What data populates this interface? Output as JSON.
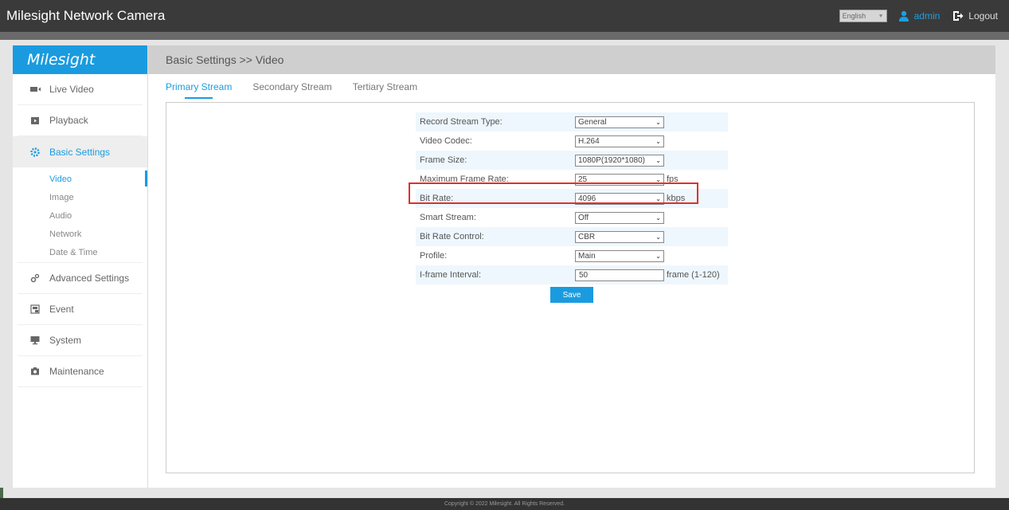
{
  "header": {
    "title": "Milesight Network Camera",
    "language": "English",
    "user": "admin",
    "logout": "Logout"
  },
  "sidebar": {
    "logo": "Milesight",
    "items": [
      {
        "label": "Live Video",
        "icon": "video-camera-icon"
      },
      {
        "label": "Playback",
        "icon": "playback-icon"
      },
      {
        "label": "Basic Settings",
        "icon": "gear-icon"
      },
      {
        "label": "Advanced Settings",
        "icon": "advanced-gear-icon"
      },
      {
        "label": "Event",
        "icon": "event-icon"
      },
      {
        "label": "System",
        "icon": "monitor-icon"
      },
      {
        "label": "Maintenance",
        "icon": "maintenance-icon"
      }
    ],
    "subitems": [
      "Video",
      "Image",
      "Audio",
      "Network",
      "Date & Time"
    ]
  },
  "main": {
    "breadcrumb": "Basic Settings >> Video",
    "tabs": [
      "Primary Stream",
      "Secondary Stream",
      "Tertiary Stream"
    ],
    "form": [
      {
        "label": "Record Stream Type:",
        "value": "General",
        "unit": ""
      },
      {
        "label": "Video Codec:",
        "value": "H.264",
        "unit": ""
      },
      {
        "label": "Frame Size:",
        "value": "1080P(1920*1080)",
        "unit": ""
      },
      {
        "label": "Maximum Frame Rate:",
        "value": "25",
        "unit": "fps"
      },
      {
        "label": "Bit Rate:",
        "value": "4096",
        "unit": "kbps"
      },
      {
        "label": "Smart Stream:",
        "value": "Off",
        "unit": ""
      },
      {
        "label": "Bit Rate Control:",
        "value": "CBR",
        "unit": ""
      },
      {
        "label": "Profile:",
        "value": "Main",
        "unit": ""
      },
      {
        "label": "I-frame Interval:",
        "value": "50",
        "unit": "frame (1-120)"
      }
    ],
    "save_label": "Save"
  },
  "footer": {
    "copyright": "Copyright © 2022 Milesight. All Rights Reserved."
  },
  "colors": {
    "accent": "#1a9be0",
    "highlight": "#e0302a"
  }
}
